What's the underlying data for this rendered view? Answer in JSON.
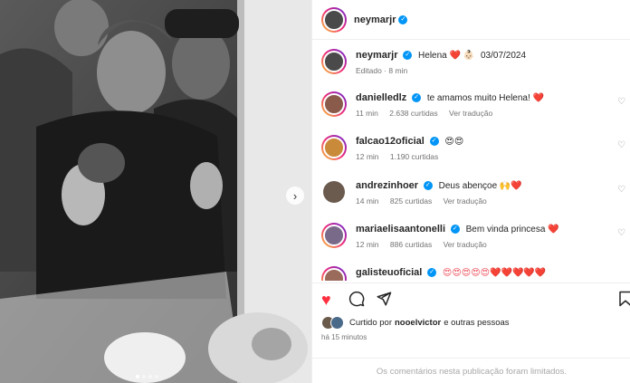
{
  "post": {
    "author": "neymarjr",
    "caption_text": "Helena",
    "caption_emojis": "❤️ 👶🏻",
    "caption_date": "03/07/2024",
    "edited": "Editado · 8 min",
    "likes_prefix": "Curtido por",
    "likes_user": "nooelvictor",
    "likes_suffix": "e outras pessoas",
    "time_ago": "há 15 minutos",
    "comments_limited": "Os comentários nesta publicação foram limitados."
  },
  "comments": [
    {
      "user": "danielledlz",
      "text": "te amamos muito Helena!",
      "emoji": "❤️",
      "time": "11 min",
      "likes": "2.638 curtidas",
      "translate": "Ver tradução",
      "avatar": "#8a5a4a"
    },
    {
      "user": "falcao12oficial",
      "text": "",
      "emoji": "😍😍",
      "time": "12 min",
      "likes": "1.190 curtidas",
      "translate": "",
      "avatar": "#c98a3a"
    },
    {
      "user": "andrezinhoer",
      "text": "Deus abençoe",
      "emoji": "🙌❤️",
      "time": "14 min",
      "likes": "825 curtidas",
      "translate": "Ver tradução",
      "avatar": "#6b5a4e"
    },
    {
      "user": "mariaelisaantonelli",
      "text": "Bem vinda princesa",
      "emoji": "❤️",
      "time": "12 min",
      "likes": "886 curtidas",
      "translate": "Ver tradução",
      "avatar": "#7a6a8a"
    },
    {
      "user": "galisteuoficial",
      "text": "",
      "emoji": "😍😍😍😍😍❤️❤️❤️❤️❤️",
      "time": "",
      "likes": "",
      "translate": "",
      "avatar": "#9a6a5a"
    }
  ],
  "icons": {
    "like": "heart-filled",
    "comment": "speech-bubble",
    "share": "paper-plane",
    "save": "bookmark",
    "next": "chevron-right",
    "verified": "verified-badge"
  },
  "colors": {
    "like_red": "#ff3040",
    "verified_blue": "#0095f6"
  }
}
